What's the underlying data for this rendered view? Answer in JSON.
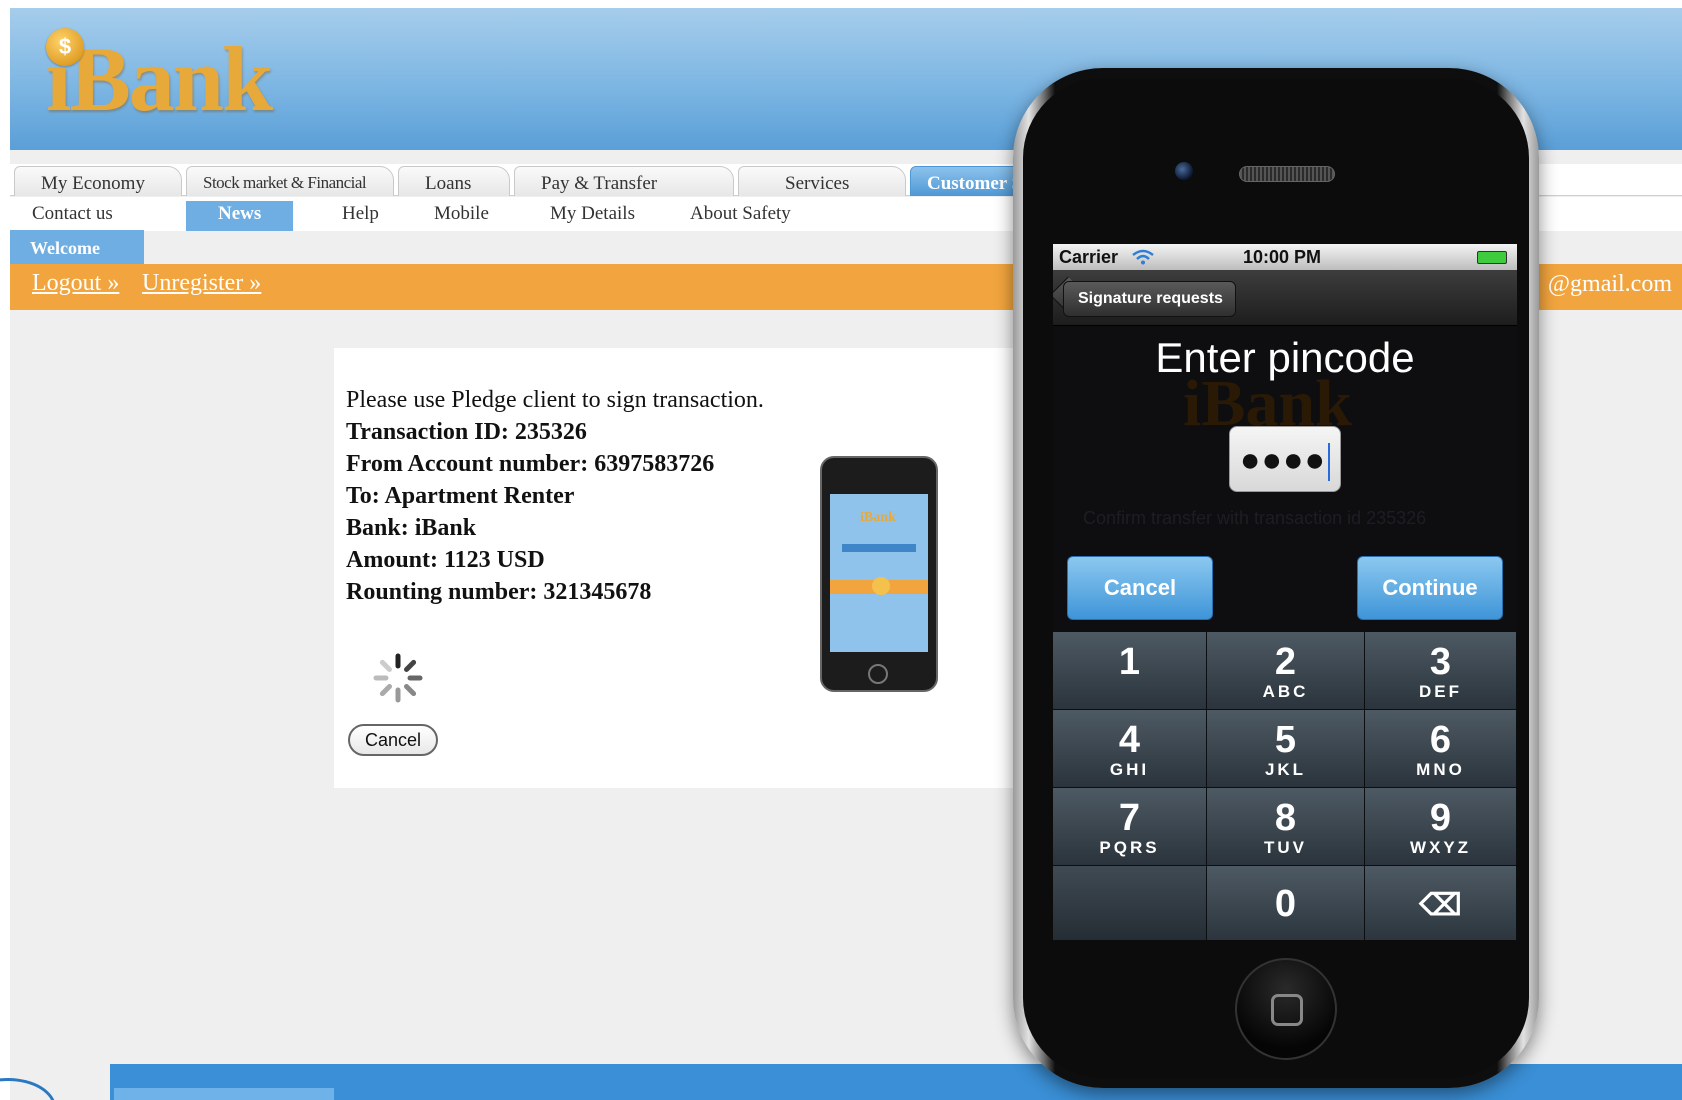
{
  "web": {
    "logo_text": "iBank",
    "logo_coin": "$",
    "main_tabs": [
      {
        "label": "My Economy"
      },
      {
        "label": "Stock market & Financial"
      },
      {
        "label": "Loans"
      },
      {
        "label": "Pay & Transfer"
      },
      {
        "label": "Services"
      },
      {
        "label": "Customer S"
      }
    ],
    "sub_nav": [
      {
        "label": "Contact us"
      },
      {
        "label": "News"
      },
      {
        "label": "Help"
      },
      {
        "label": "Mobile"
      },
      {
        "label": "My Details"
      },
      {
        "label": "About Safety"
      }
    ],
    "welcome_label": "Welcome",
    "logout_link": "Logout »",
    "unregister_link": "Unregister »",
    "email_fragment": "@gmail.com",
    "message": {
      "intro": "Please use Pledge client to sign transaction.",
      "transaction_id": "Transaction ID: 235326",
      "from_account": "From Account number: 6397583726",
      "to": "To: Apartment Renter",
      "bank": "Bank: iBank",
      "amount": "Amount: 1123 USD",
      "routing": "Rounting number: 321345678"
    },
    "small_phone_logo": "iBank",
    "cancel_label": "Cancel"
  },
  "phone": {
    "status": {
      "carrier": "Carrier",
      "time": "10:00 PM"
    },
    "back_label": "Signature requests",
    "title": "Enter pincode",
    "ghost_logo": "iBank",
    "pin_value": "●●●●",
    "ghost_text": "Confirm transfer with transaction id 235326",
    "cancel_label": "Cancel",
    "continue_label": "Continue",
    "keypad": [
      {
        "num": "1",
        "letters": ""
      },
      {
        "num": "2",
        "letters": "ABC"
      },
      {
        "num": "3",
        "letters": "DEF"
      },
      {
        "num": "4",
        "letters": "GHI"
      },
      {
        "num": "5",
        "letters": "JKL"
      },
      {
        "num": "6",
        "letters": "MNO"
      },
      {
        "num": "7",
        "letters": "PQRS"
      },
      {
        "num": "8",
        "letters": "TUV"
      },
      {
        "num": "9",
        "letters": "WXYZ"
      },
      {
        "num": "",
        "letters": ""
      },
      {
        "num": "0",
        "letters": ""
      },
      {
        "num": "⌫",
        "letters": ""
      }
    ]
  },
  "colors": {
    "header_blue": "#7db6e3",
    "accent_orange": "#f2a53e",
    "logo_gold": "#e7a93a",
    "ios_button_blue": "#3e95d8",
    "keypad_slate": "#3a454e"
  },
  "icons": [
    "wifi-icon",
    "battery-icon",
    "spinner-icon",
    "backspace-icon",
    "home-button-icon",
    "coin-icon"
  ]
}
